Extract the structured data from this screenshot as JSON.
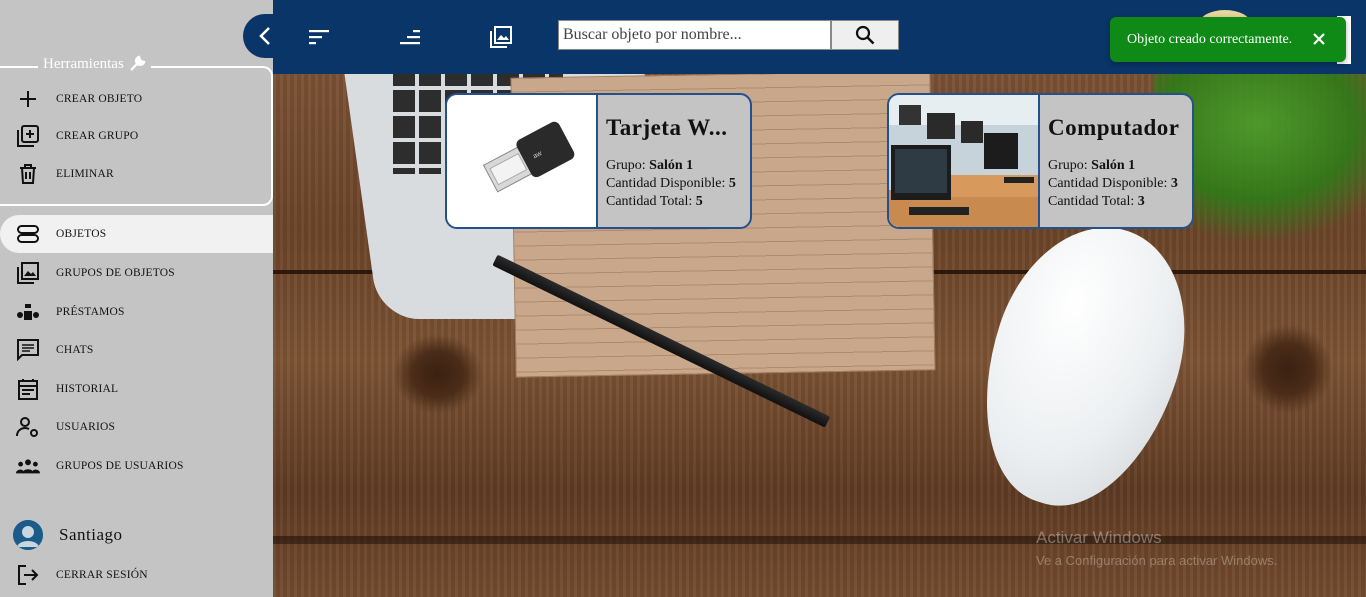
{
  "topbar": {
    "search_placeholder": "Buscar objeto por nombre...",
    "icons": [
      "sort-icon",
      "sort-right-icon",
      "image-gallery-icon",
      "search-icon"
    ]
  },
  "toast": {
    "message": "Objeto creado correctamente.",
    "color": "#0f8a16"
  },
  "sidebar": {
    "tools_title": "Herramientas",
    "tools": [
      {
        "label": "CREAR OBJETO",
        "icon": "plus-icon"
      },
      {
        "label": "CREAR GRUPO",
        "icon": "add-to-library-icon"
      },
      {
        "label": "ELIMINAR",
        "icon": "trash-icon"
      }
    ],
    "nav": [
      {
        "label": "OBJETOS",
        "icon": "objects-icon",
        "active": true
      },
      {
        "label": "GRUPOS DE OBJETOS",
        "icon": "photo-library-icon"
      },
      {
        "label": "PRÉSTAMOS",
        "icon": "loans-icon"
      },
      {
        "label": "CHATS",
        "icon": "chat-icon"
      },
      {
        "label": "HISTORIAL",
        "icon": "calendar-icon"
      },
      {
        "label": "USUARIOS",
        "icon": "user-settings-icon"
      },
      {
        "label": "GRUPOS DE USUARIOS",
        "icon": "groups-icon"
      }
    ],
    "user": {
      "name": "Santiago"
    },
    "logout": {
      "label": "CERRAR SESIÓN",
      "icon": "logout-icon"
    }
  },
  "cards": [
    {
      "title": "Tarjeta W...",
      "group_label": "Grupo:",
      "group": "Salón 1",
      "available_label": "Cantidad Disponible:",
      "available": "5",
      "total_label": "Cantidad Total:",
      "total": "5",
      "image": "usb-wifi-adapter"
    },
    {
      "title": "Computador",
      "group_label": "Grupo:",
      "group": "Salón 1",
      "available_label": "Cantidad Disponible:",
      "available": "3",
      "total_label": "Cantidad Total:",
      "total": "3",
      "image": "computer-lab"
    }
  ],
  "watermark": {
    "line1": "Activar Windows",
    "line2": "Ve a Configuración para activar Windows."
  },
  "colors": {
    "topbar": "#0a3569",
    "sidebar": "#c4c4c4",
    "card_border": "#24508e"
  }
}
